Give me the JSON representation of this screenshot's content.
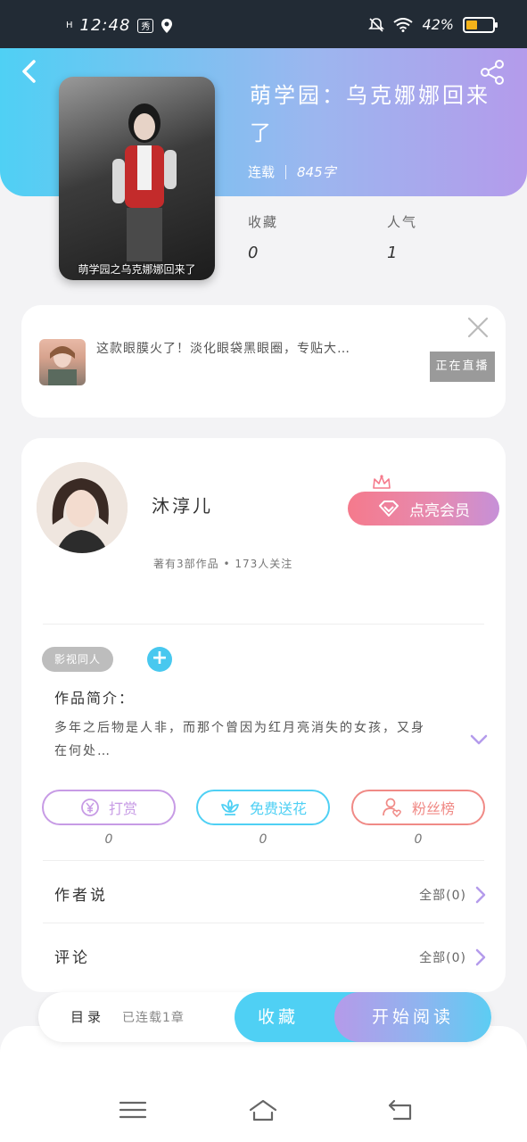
{
  "status_bar": {
    "signal": "H",
    "time": "12:48",
    "app_badge": "秀",
    "battery_text": "42%",
    "battery_level": 0.42,
    "battery_color": "#f3b21a"
  },
  "header": {
    "gradient_start": "#4fd0f4",
    "gradient_end": "#b49beb"
  },
  "book": {
    "title": "萌学园：乌克娜娜回来了",
    "status": "连载",
    "word_count": "845字",
    "cover_caption": "萌学园之乌克娜娜回来了",
    "stats": [
      {
        "label": "收藏",
        "value": "0"
      },
      {
        "label": "人气",
        "value": "1"
      }
    ]
  },
  "ad": {
    "text": "这款眼膜火了！淡化眼袋黑眼圈，专贴大…",
    "status": "正在直播"
  },
  "author": {
    "name": "沐淳儿",
    "meta": "著有3部作品 • 173人关注",
    "vip_label": "点亮会员"
  },
  "tags": [
    "影视同人"
  ],
  "intro": {
    "title": "作品简介：",
    "text": "多年之后物是人非，而那个曾因为红月亮消失的女孩，又身在何处…"
  },
  "actions": [
    {
      "label": "打赏",
      "count": "0",
      "color": "#c79be5"
    },
    {
      "label": "免费送花",
      "count": "0",
      "color": "#4fd0f4"
    },
    {
      "label": "粉丝榜",
      "count": "0",
      "color": "#f08a86"
    }
  ],
  "rows": [
    {
      "title": "作者说",
      "right": "全部(0)"
    },
    {
      "title": "评论",
      "right": "全部(0)"
    }
  ],
  "bottom": {
    "toc_label": "目录",
    "toc_status": "已连载1章",
    "collect_label": "收藏",
    "read_label": "开始阅读"
  }
}
